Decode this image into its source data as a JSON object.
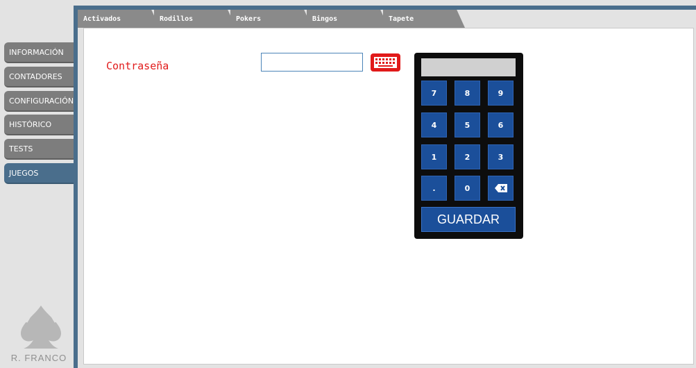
{
  "sidebar": {
    "items": [
      {
        "label": "INFORMACIÓN"
      },
      {
        "label": "CONTADORES"
      },
      {
        "label": "CONFIGURACIÓN"
      },
      {
        "label": "HISTÓRICO"
      },
      {
        "label": "TESTS"
      },
      {
        "label": "JUEGOS",
        "active": true
      }
    ],
    "brand": "R. FRANCO"
  },
  "tabs": [
    {
      "label": "Activados"
    },
    {
      "label": "Rodillos"
    },
    {
      "label": "Pokers"
    },
    {
      "label": "Bingos"
    },
    {
      "label": "Tapete"
    }
  ],
  "form": {
    "password_label": "Contraseña",
    "password_value": ""
  },
  "numpad": {
    "display_value": "",
    "keys": [
      "7",
      "8",
      "9",
      "4",
      "5",
      "6",
      "1",
      "2",
      "3",
      ".",
      "0"
    ],
    "backspace_icon": "backspace-icon",
    "save_label": "GUARDAR"
  },
  "colors": {
    "accent": "#4a6e8c",
    "label_red": "#e11a1a",
    "key_blue": "#1b4f9a"
  }
}
